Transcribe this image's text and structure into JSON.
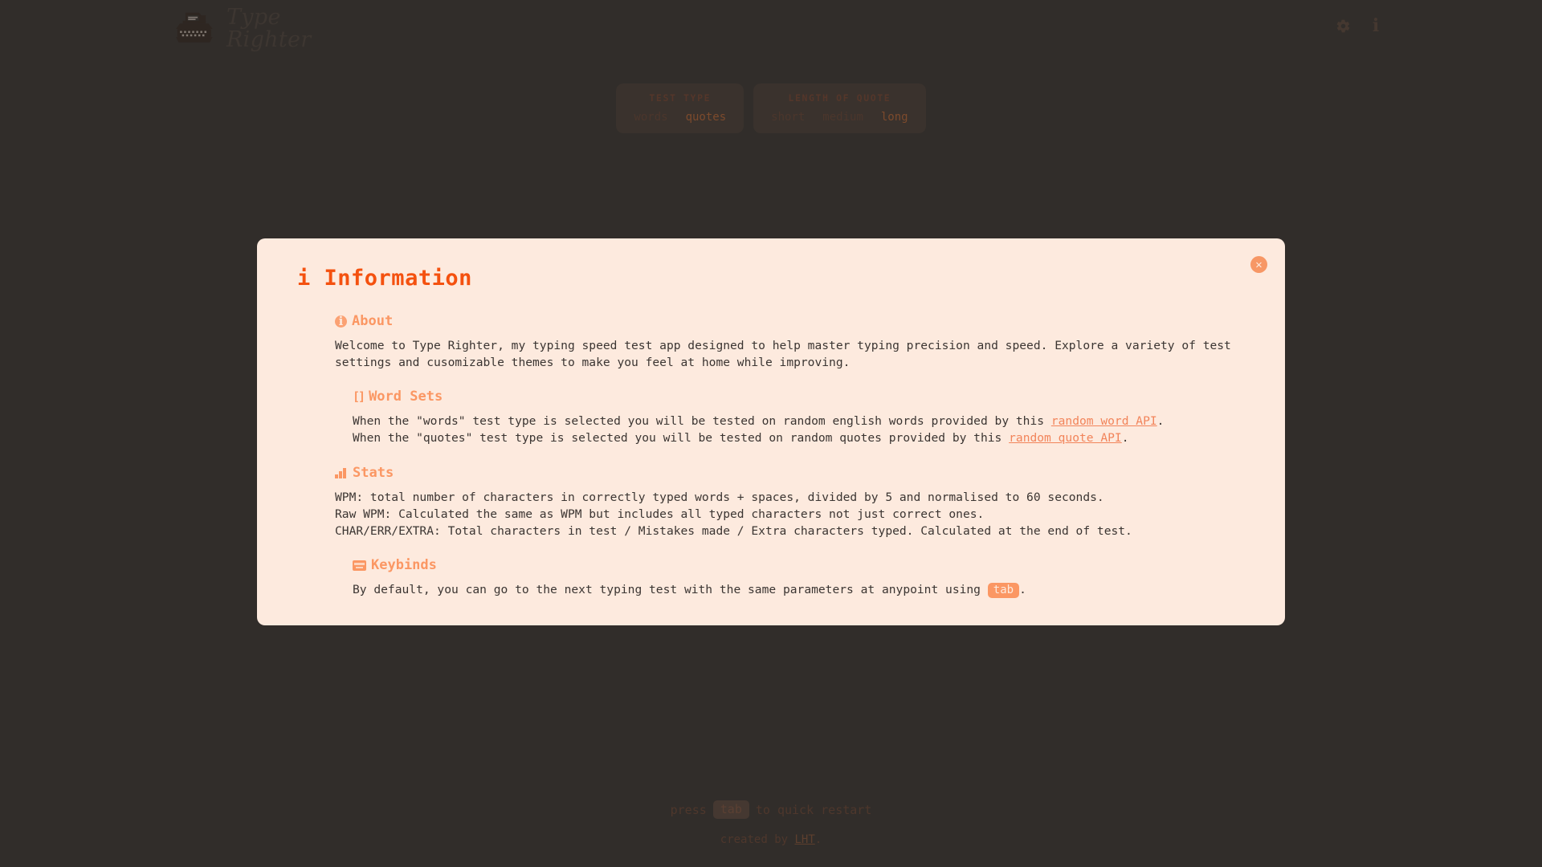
{
  "app": {
    "brand_line1": "Type",
    "brand_line2": "Righter",
    "logo_icon": "typewriter-icon"
  },
  "topbar": {
    "settings_icon": "gear-icon",
    "info_icon": "info-icon",
    "info_glyph": "i"
  },
  "settings": {
    "panels": [
      {
        "title": "TEST TYPE",
        "options": [
          {
            "label": "words",
            "active": false
          },
          {
            "label": "quotes",
            "active": true
          }
        ]
      },
      {
        "title": "LENGTH OF QUOTE",
        "options": [
          {
            "label": "short",
            "active": false
          },
          {
            "label": "medium",
            "active": false
          },
          {
            "label": "long",
            "active": true
          }
        ]
      }
    ]
  },
  "modal": {
    "title_icon": "i",
    "title": "Information",
    "close_glyph": "✕",
    "sections": {
      "about": {
        "icon": "info-circle-icon",
        "heading": "About",
        "lines": [
          "Welcome to Type Righter, my typing speed test app designed to help master typing precision and speed. Explore a variety of test",
          "settings and cusomizable themes to make you feel at home while improving."
        ]
      },
      "word_sets": {
        "icon": "missing-glyph-icon",
        "icon_glyph": "[]",
        "heading": "Word Sets",
        "line1_pre": "When the \"words\" test type is selected you will be tested on random english words provided by this ",
        "line1_link": "random word API",
        "line1_post": ".",
        "line2_pre": "When the \"quotes\" test type is selected you will be tested on random quotes provided by this ",
        "line2_link": "random quote API",
        "line2_post": "."
      },
      "stats": {
        "icon": "chart-increasing-icon",
        "heading": "Stats",
        "lines": [
          "WPM: total number of characters in correctly typed words + spaces, divided by 5 and normalised to 60 seconds.",
          "Raw WPM: Calculated the same as WPM but includes all typed characters not just correct ones.",
          "CHAR/ERR/EXTRA: Total characters in test / Mistakes made / Extra characters typed. Calculated at the end of test."
        ]
      },
      "keybinds": {
        "icon": "keyboard-icon",
        "heading": "Keybinds",
        "line_pre": "By default, you can go to the next typing test with the same parameters at anypoint using ",
        "key": "tab",
        "line_post": "."
      }
    }
  },
  "footer": {
    "hint_pre": "press",
    "hint_key": "tab",
    "hint_post": "to quick restart",
    "credit_pre": "created by ",
    "credit_link": "LHT",
    "credit_post": "."
  },
  "colors": {
    "background": "#312d2a",
    "modal_bg": "#fdeade",
    "accent": "#f4510f",
    "accent_light": "#fb9763",
    "link": "#f2845a",
    "body_text": "#3b3532"
  }
}
